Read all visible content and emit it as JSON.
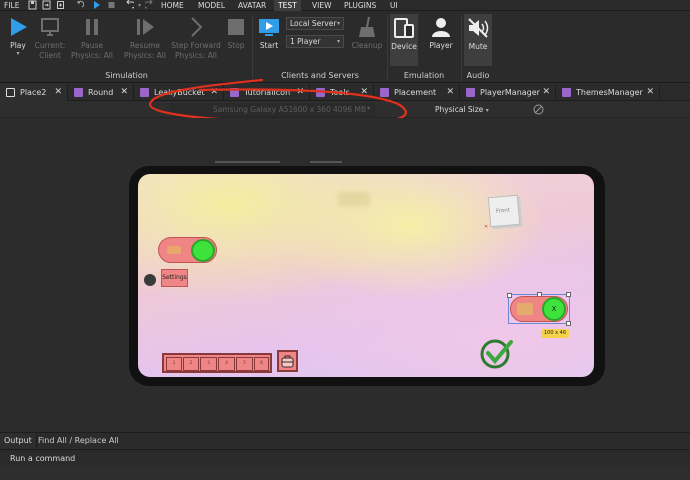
{
  "menu": {
    "file": "FILE",
    "tabs": [
      "HOME",
      "MODEL",
      "AVATAR",
      "TEST",
      "VIEW",
      "PLUGINS",
      "UI"
    ],
    "active_tab": "TEST"
  },
  "ribbon": {
    "simulation": {
      "label": "Simulation",
      "play": "Play",
      "current_client": [
        "Current:",
        "Client"
      ],
      "pause": [
        "Pause",
        "Physics: All"
      ],
      "resume": [
        "Resume",
        "Physics: All"
      ],
      "step_forward": [
        "Step Forward",
        "Physics: All"
      ],
      "stop": "Stop"
    },
    "clients_servers": {
      "label": "Clients and Servers",
      "start": "Start",
      "server_select": "Local Server",
      "players_select": "1 Player",
      "cleanup": "Cleanup"
    },
    "emulation": {
      "label": "Emulation",
      "device": "Device",
      "player": "Player"
    },
    "audio": {
      "label": "Audio",
      "mute": "Mute"
    }
  },
  "file_tabs": [
    {
      "label": "Place2",
      "kind": "place"
    },
    {
      "label": "Round",
      "kind": "script"
    },
    {
      "label": "LeakyBucket",
      "kind": "script"
    },
    {
      "label": "TutorialIcon",
      "kind": "script"
    },
    {
      "label": "Tools",
      "kind": "script"
    },
    {
      "label": "Placement",
      "kind": "script"
    },
    {
      "label": "PlayerManager",
      "kind": "script"
    },
    {
      "label": "ThemesManager",
      "kind": "script"
    }
  ],
  "device_bar": {
    "device": "Samsung Galaxy A51",
    "resolution": "600 x 360",
    "memory": "4096 MB",
    "size_mode": "Physical Size"
  },
  "game": {
    "settings_label": "Settings",
    "part_label": "Front",
    "close_label": "X",
    "size_tag": "100 x 46",
    "hotbar_slots": [
      "1",
      "2",
      "3",
      "4",
      "5",
      "6"
    ]
  },
  "bottom": {
    "output_tab": "Output",
    "find_tab": "Find All / Replace All",
    "command_placeholder": "Run a command"
  },
  "colors": {
    "accent_blue": "#2f9de8",
    "toggle_green": "#3de23d",
    "toggle_red": "#f07a7a",
    "annotation_red": "#e0301e"
  }
}
